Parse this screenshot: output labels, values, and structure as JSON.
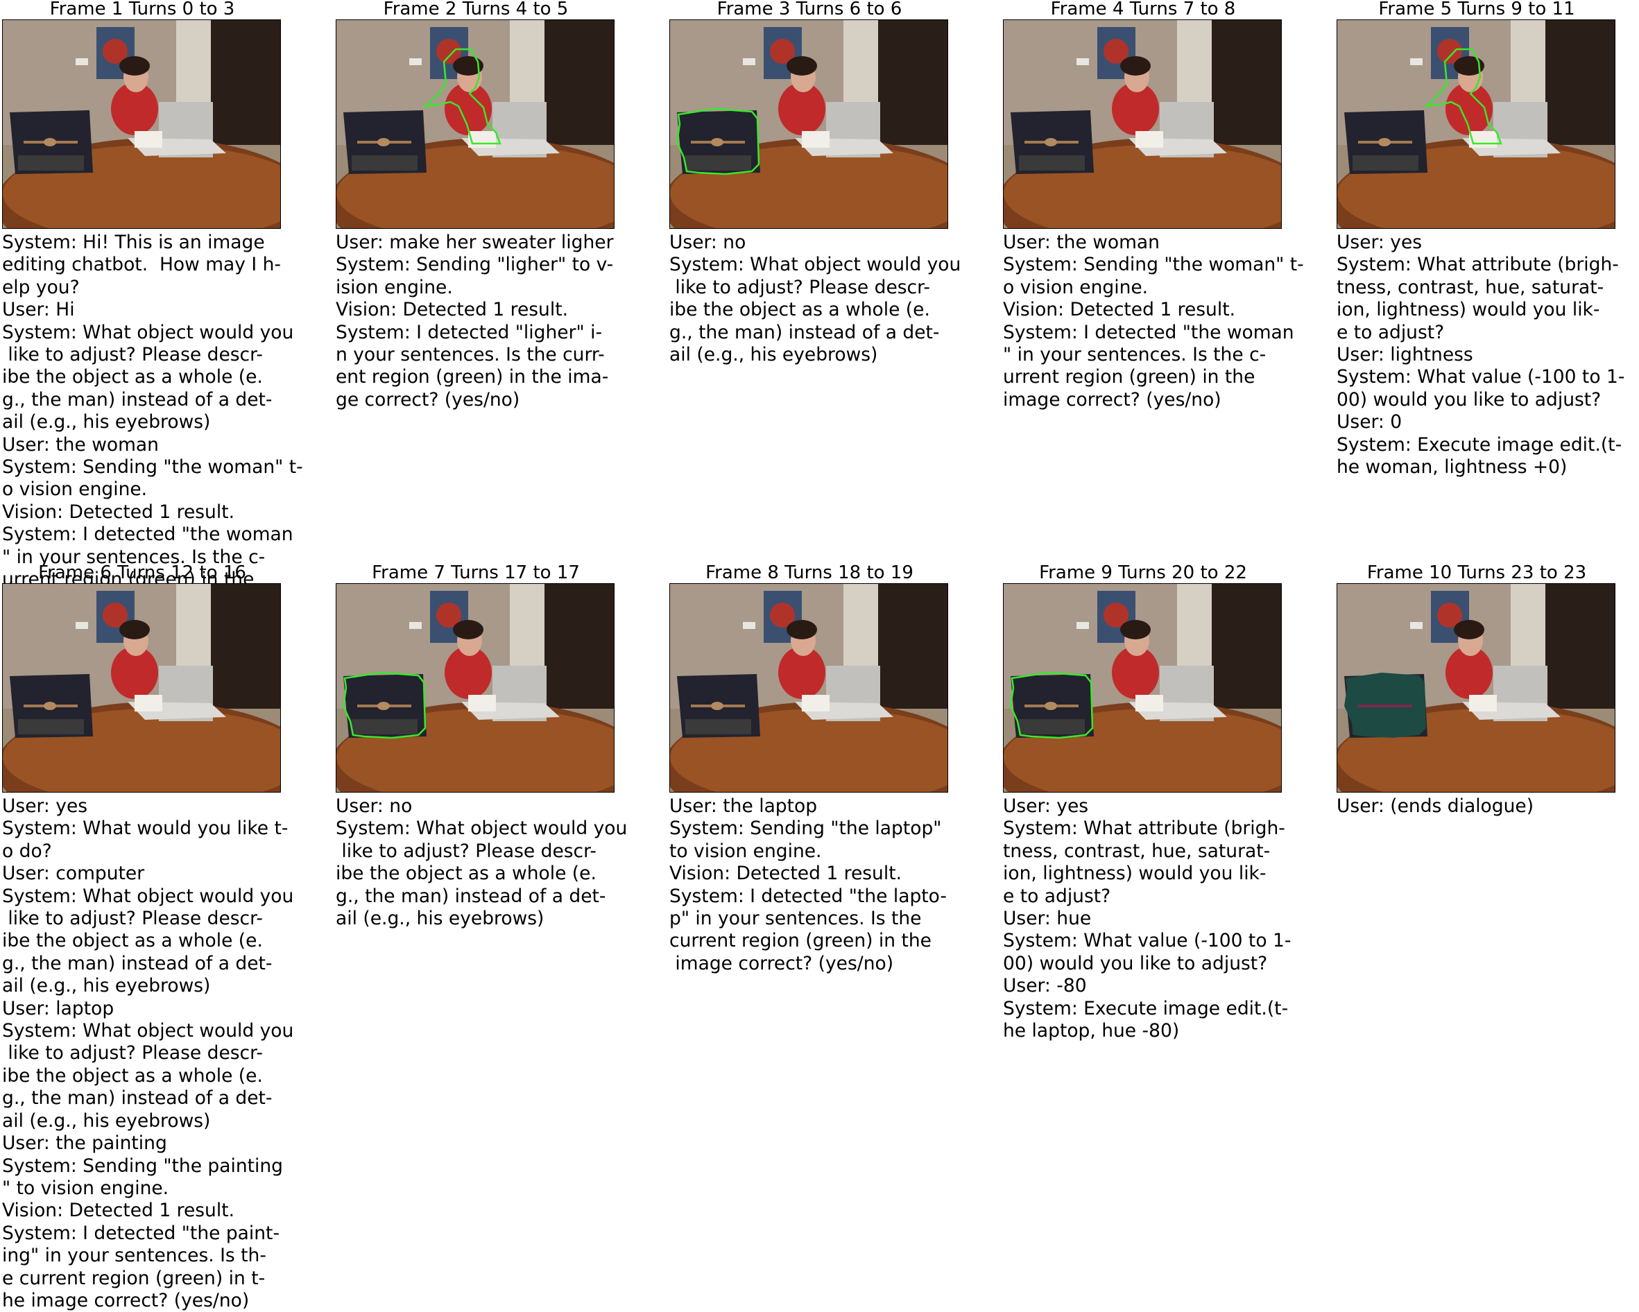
{
  "frames": [
    {
      "title": "Frame 1 Turns 0 to 3",
      "highlight": "none",
      "lines": [
        "System: Hi! This is an image",
        "editing chatbot.  How may I h-",
        "elp you?",
        "User: Hi",
        "System: What object would you",
        " like to adjust? Please descr-",
        "ibe the object as a whole (e.",
        "g., the man) instead of a det-",
        "ail (e.g., his eyebrows)",
        "User: the woman",
        "System: Sending \"the woman\" t-",
        "o vision engine.",
        "Vision: Detected 1 result.",
        "System: I detected \"the woman",
        "\" in your sentences. Is the c-",
        "urrent region (green) in the"
      ]
    },
    {
      "title": "Frame 2 Turns 4 to 5",
      "highlight": "woman",
      "lines": [
        "User: make her sweater ligher",
        "System: Sending \"ligher\" to v-",
        "ision engine.",
        "Vision: Detected 1 result.",
        "System: I detected \"ligher\" i-",
        "n your sentences. Is the curr-",
        "ent region (green) in the ima-",
        "ge correct? (yes/no)"
      ]
    },
    {
      "title": "Frame 3 Turns 6 to 6",
      "highlight": "laptop",
      "lines": [
        "User: no",
        "System: What object would you",
        " like to adjust? Please descr-",
        "ibe the object as a whole (e.",
        "g., the man) instead of a det-",
        "ail (e.g., his eyebrows)"
      ]
    },
    {
      "title": "Frame 4 Turns 7 to 8",
      "highlight": "none",
      "lines": [
        "User: the woman",
        "System: Sending \"the woman\" t-",
        "o vision engine.",
        "Vision: Detected 1 result.",
        "System: I detected \"the woman",
        "\" in your sentences. Is the c-",
        "urrent region (green) in the",
        "image correct? (yes/no)"
      ]
    },
    {
      "title": "Frame 5 Turns 9 to 11",
      "highlight": "woman",
      "lines": [
        "User: yes",
        "System: What attribute (brigh-",
        "tness, contrast, hue, saturat-",
        "ion, lightness) would you lik-",
        "e to adjust?",
        "User: lightness",
        "System: What value (-100 to 1-",
        "00) would you like to adjust?",
        "User: 0",
        "System: Execute image edit.(t-",
        "he woman, lightness +0)"
      ]
    },
    {
      "title": "Frame 6 Turns 12 to 16",
      "highlight": "none",
      "lines": [
        "User: yes",
        "System: What would you like t-",
        "o do?",
        "User: computer",
        "System: What object would you",
        " like to adjust? Please descr-",
        "ibe the object as a whole (e.",
        "g., the man) instead of a det-",
        "ail (e.g., his eyebrows)",
        "User: laptop",
        "System: What object would you",
        " like to adjust? Please descr-",
        "ibe the object as a whole (e.",
        "g., the man) instead of a det-",
        "ail (e.g., his eyebrows)",
        "User: the painting",
        "System: Sending \"the painting",
        "\" to vision engine.",
        "Vision: Detected 1 result.",
        "System: I detected \"the paint-",
        "ing\" in your sentences. Is th-",
        "e current region (green) in t-",
        "he image correct? (yes/no)"
      ]
    },
    {
      "title": "Frame 7 Turns 17 to 17",
      "highlight": "laptop",
      "lines": [
        "User: no",
        "System: What object would you",
        " like to adjust? Please descr-",
        "ibe the object as a whole (e.",
        "g., the man) instead of a det-",
        "ail (e.g., his eyebrows)"
      ]
    },
    {
      "title": "Frame 8 Turns 18 to 19",
      "highlight": "none",
      "lines": [
        "User: the laptop",
        "System: Sending \"the laptop\"",
        "to vision engine.",
        "Vision: Detected 1 result.",
        "System: I detected \"the lapto-",
        "p\" in your sentences. Is the",
        "current region (green) in the",
        " image correct? (yes/no)"
      ]
    },
    {
      "title": "Frame 9 Turns 20 to 22",
      "highlight": "laptop",
      "lines": [
        "User: yes",
        "System: What attribute (brigh-",
        "tness, contrast, hue, saturat-",
        "ion, lightness) would you lik-",
        "e to adjust?",
        "User: hue",
        "System: What value (-100 to 1-",
        "00) would you like to adjust?",
        "User: -80",
        "System: Execute image edit.(t-",
        "he laptop, hue -80)"
      ]
    },
    {
      "title": "Frame 10 Turns 23 to 23",
      "highlight": "hue-edited",
      "lines": [
        "User: (ends dialogue)"
      ]
    }
  ]
}
